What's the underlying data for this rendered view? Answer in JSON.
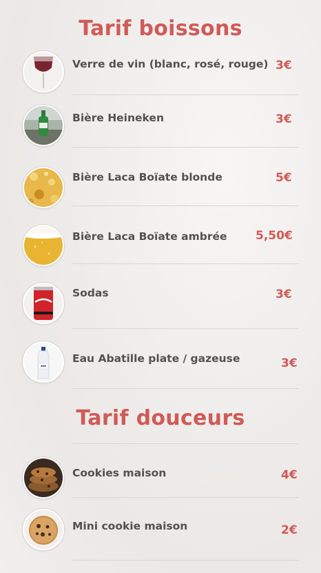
{
  "drinks": {
    "title": "Tarif boissons",
    "items": [
      {
        "name": "Verre de vin (blanc, rosé, rouge)",
        "price": "3€",
        "image": "wine-glass-icon"
      },
      {
        "name": "Bière Heineken",
        "price": "3€",
        "image": "beer-bottle-icon"
      },
      {
        "name": "Bière Laca Boïate blonde",
        "price": "5€",
        "image": "beer-glass-blonde-icon"
      },
      {
        "name": "Bière Laca Boïate ambrée",
        "price": "5,50€",
        "image": "beer-glass-amber-icon"
      },
      {
        "name": "Sodas",
        "price": "3€",
        "image": "soda-can-icon"
      },
      {
        "name": "Eau Abatille plate / gazeuse",
        "price": "3€",
        "image": "water-bottle-icon"
      }
    ]
  },
  "sweets": {
    "title": "Tarif douceurs",
    "items": [
      {
        "name": "Cookies maison",
        "price": "4€",
        "image": "cookie-stack-icon"
      },
      {
        "name": "Mini cookie maison",
        "price": "2€",
        "image": "mini-cookie-icon"
      }
    ]
  },
  "colors": {
    "accent": "#cf5b58",
    "text": "#555050",
    "divider": "#d9d6d3"
  }
}
